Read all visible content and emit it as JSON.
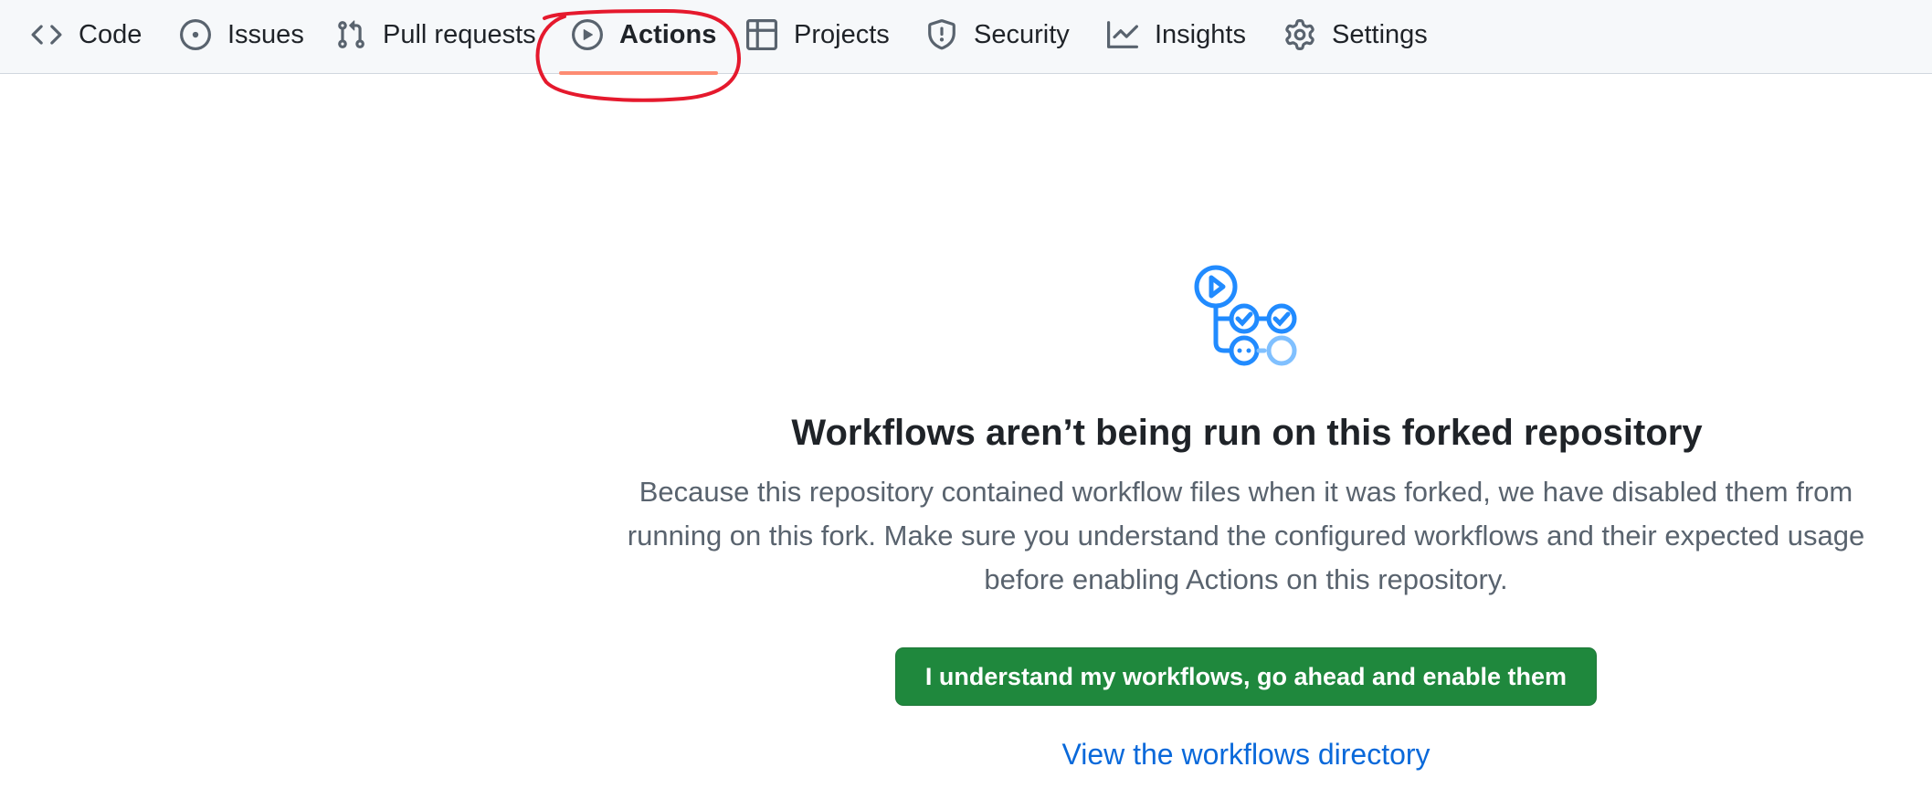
{
  "nav": {
    "tabs": [
      {
        "label": "Code",
        "icon": "code-icon"
      },
      {
        "label": "Issues",
        "icon": "issue-opened-icon"
      },
      {
        "label": "Pull requests",
        "icon": "git-pull-request-icon"
      },
      {
        "label": "Actions",
        "icon": "play-icon",
        "active": true
      },
      {
        "label": "Projects",
        "icon": "table-icon"
      },
      {
        "label": "Security",
        "icon": "shield-icon"
      },
      {
        "label": "Insights",
        "icon": "graph-icon"
      },
      {
        "label": "Settings",
        "icon": "gear-icon"
      }
    ]
  },
  "main": {
    "icon": "workflow-icon",
    "title": "Workflows aren’t being run on this forked repository",
    "description": "Because this repository contained workflow files when it was forked, we have disabled them from running on this fork. Make sure you understand the configured workflows and their expected usage before enabling Actions on this repository.",
    "enable_button": "I understand my workflows, go ahead and enable them",
    "directory_link": "View the workflows directory"
  },
  "colors": {
    "accent_underline": "#fd8c73",
    "primary_button": "#1f883d",
    "link": "#0969da",
    "annotation_circle": "#e5192d",
    "icon_blue": "#218bff"
  }
}
